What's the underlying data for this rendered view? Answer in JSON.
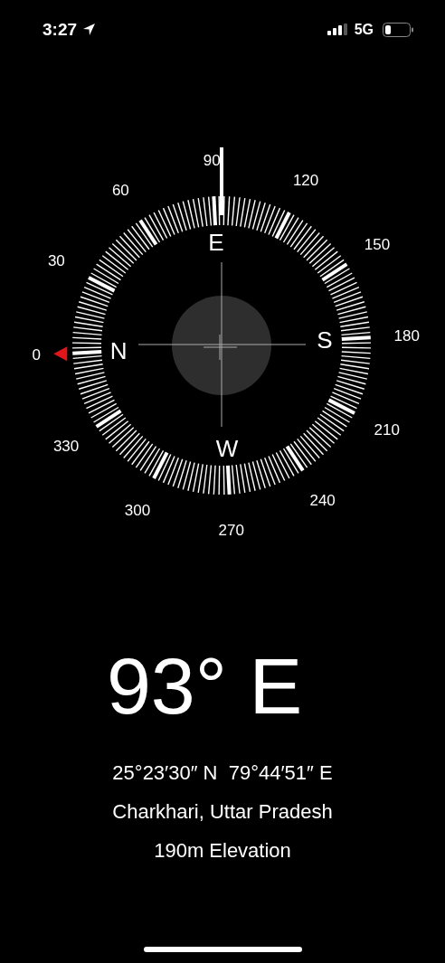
{
  "status_bar": {
    "time": "3:27",
    "network": "5G"
  },
  "compass": {
    "dial_labels": [
      "0",
      "30",
      "60",
      "90",
      "120",
      "150",
      "180",
      "210",
      "240",
      "270",
      "300",
      "330"
    ],
    "cardinals": [
      "N",
      "E",
      "S",
      "W"
    ]
  },
  "heading": "93° E",
  "coordinates": "25°23′30″ N  79°44′51″ E",
  "location": "Charkhari, Uttar Pradesh",
  "elevation": "190m Elevation"
}
